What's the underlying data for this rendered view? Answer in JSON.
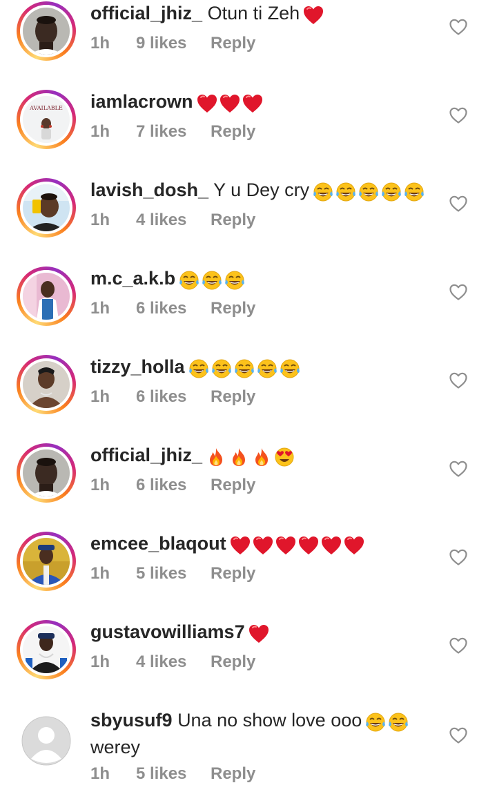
{
  "comments": [
    {
      "username": "official_jhiz_",
      "text": "Otun ti Zeh",
      "emojis": [
        "heart"
      ],
      "time": "1h",
      "likes": "9 likes",
      "reply": "Reply",
      "avatar": "avatar-man-dark"
    },
    {
      "username": "iamlacrown",
      "text": "",
      "emojis": [
        "heart",
        "heart",
        "heart"
      ],
      "time": "1h",
      "likes": "7 likes",
      "reply": "Reply",
      "avatar": "avatar-available-poster",
      "avatar_text": "AVAILABLE"
    },
    {
      "username": "lavish_dosh_",
      "text": "Y u Dey cry",
      "emojis": [
        "laugh",
        "laugh",
        "laugh",
        "laugh",
        "laugh"
      ],
      "time": "1h",
      "likes": "4 likes",
      "reply": "Reply",
      "avatar": "avatar-man-yellow"
    },
    {
      "username": "m.c_a.k.b",
      "text": "",
      "emojis": [
        "laugh",
        "laugh",
        "laugh"
      ],
      "time": "1h",
      "likes": "6 likes",
      "reply": "Reply",
      "avatar": "avatar-man-pink"
    },
    {
      "username": "tizzy_holla",
      "text": "",
      "emojis": [
        "laugh",
        "laugh",
        "laugh",
        "laugh",
        "laugh"
      ],
      "time": "1h",
      "likes": "6 likes",
      "reply": "Reply",
      "avatar": "avatar-man-shirtless"
    },
    {
      "username": "official_jhiz_",
      "text": "",
      "emojis": [
        "fire",
        "fire",
        "fire",
        "hearteyes"
      ],
      "time": "1h",
      "likes": "6 likes",
      "reply": "Reply",
      "avatar": "avatar-man-dark"
    },
    {
      "username": "emcee_blaqout",
      "text": "",
      "emojis": [
        "heart",
        "heart",
        "heart",
        "heart",
        "heart",
        "heart"
      ],
      "time": "1h",
      "likes": "5 likes",
      "reply": "Reply",
      "avatar": "avatar-man-blue"
    },
    {
      "username": "gustavowilliams7",
      "text": "",
      "emojis": [
        "heart"
      ],
      "time": "1h",
      "likes": "4 likes",
      "reply": "Reply",
      "avatar": "avatar-man-chains"
    },
    {
      "username": "sbyusuf9",
      "text": "Una no show love ooo",
      "emojis": [
        "laugh",
        "laugh"
      ],
      "text2": "werey",
      "time": "1h",
      "likes": "5 likes",
      "reply": "Reply",
      "avatar": "avatar-default-placeholder"
    }
  ],
  "colors": {
    "meta": "#8e8e8e",
    "text": "#262626",
    "heart_red": "#e0162b",
    "emoji_yellow": "#fcc21b"
  }
}
